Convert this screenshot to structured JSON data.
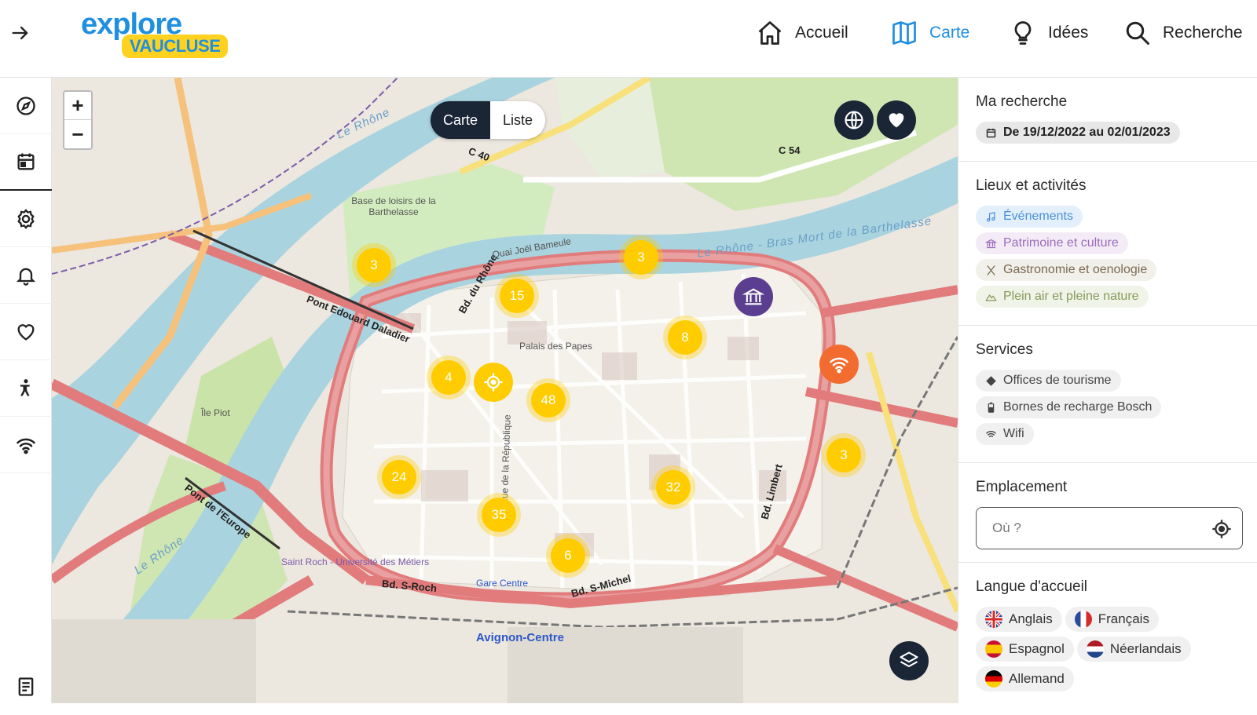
{
  "header": {
    "logo_top": "explore",
    "logo_bottom": "VAUCLUSE",
    "nav": [
      {
        "label": "Accueil",
        "icon": "home-icon"
      },
      {
        "label": "Carte",
        "icon": "map-icon",
        "active": true
      },
      {
        "label": "Idées",
        "icon": "lightbulb-icon"
      },
      {
        "label": "Recherche",
        "icon": "search-icon"
      }
    ]
  },
  "rail": {
    "items": [
      "compass-icon",
      "calendar-icon",
      "settings-icon",
      "bell-icon",
      "heart-icon",
      "accessibility-icon",
      "wifi-icon",
      "document-icon"
    ]
  },
  "map": {
    "zoom_in": "+",
    "zoom_out": "−",
    "toggle": {
      "carte": "Carte",
      "liste": "Liste"
    },
    "clusters": [
      "3",
      "3",
      "15",
      "8",
      "4",
      "48",
      "24",
      "35",
      "32",
      "6",
      "3"
    ],
    "labels": {
      "river1": "Le Rhône",
      "river2": "Le Rhône - Bras Mort de la Barthelasse",
      "river3": "Le Rhône - Bras Mort de la Barthelasse",
      "river4": "Le Rhône",
      "station": "Avignon-Centre",
      "palais": "Palais des Papes",
      "pont_daladier": "Pont Edouard Daladier",
      "pont_europe": "Pont de l'Europe",
      "bd_rhone": "Bd. du Rhône",
      "bd_limbert": "Bd. Limbert",
      "bd_stroch": "Bd. S-Roch",
      "bd_stmichel": "Bd. S-Michel",
      "base_loisirs": "Base de loisirs de la Barthelasse",
      "quai": "Quai Joël Bameule",
      "c54": "C 54",
      "c40": "C 40",
      "rue_rep": "Rue de la République",
      "ile_piot": "Île Piot",
      "gare": "Gare Centre",
      "saint_roch": "Saint Roch - Université des Métiers"
    }
  },
  "panel": {
    "recherche": {
      "title": "Ma recherche",
      "date": "De 19/12/2022 au 02/01/2023"
    },
    "lieux": {
      "title": "Lieux et activités",
      "items": [
        "Événements",
        "Patrimoine et culture",
        "Gastronomie et oenologie",
        "Plein air et pleine nature"
      ]
    },
    "services": {
      "title": "Services",
      "items": [
        "Offices de tourisme",
        "Bornes de recharge Bosch",
        "Wifi"
      ]
    },
    "emplacement": {
      "title": "Emplacement",
      "placeholder": "Où ?"
    },
    "langue": {
      "title": "Langue d'accueil",
      "items": [
        "Anglais",
        "Français",
        "Espagnol",
        "Néerlandais",
        "Allemand"
      ]
    }
  },
  "colors": {
    "brand_blue": "#1f8fe0",
    "brand_yellow": "#ffd21f",
    "cluster": "#ffcc00",
    "dark": "#1a2536",
    "wifi_poi": "#f26b2f",
    "museum_poi": "#5b3e8f"
  }
}
